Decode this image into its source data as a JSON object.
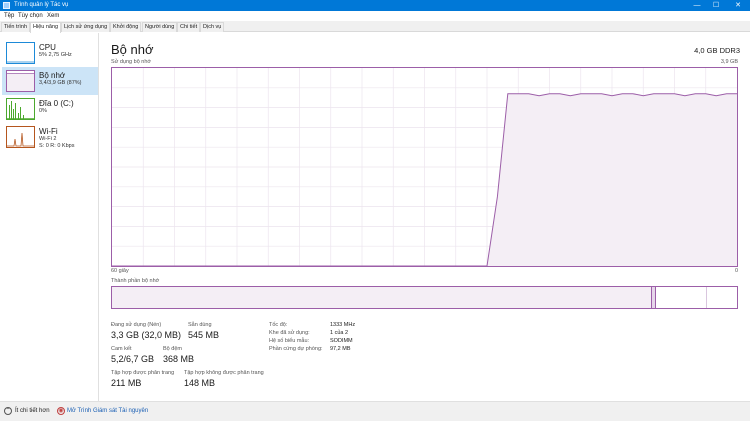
{
  "window": {
    "title": "Trình quản lý Tác vụ",
    "minimize": "—",
    "maximize": "☐",
    "close": "✕"
  },
  "menu": [
    "Tệp",
    "Tùy chọn",
    "Xem"
  ],
  "tabs": [
    "Tiến trình",
    "Hiệu năng",
    "Lịch sử ứng dụng",
    "Khởi động",
    "Người dùng",
    "Chi tiết",
    "Dịch vụ"
  ],
  "active_tab": "Hiệu năng",
  "sidebar": [
    {
      "name": "CPU",
      "sub": "5% 2,75 GHz",
      "color": "#1d8ad8"
    },
    {
      "name": "Bộ nhớ",
      "sub": "3,4/3,9 GB (87%)",
      "color": "#9c5ea8",
      "fill_fraction": 0.87
    },
    {
      "name": "Đĩa 0 (C:)",
      "sub": "0%",
      "color": "#4ca82e"
    },
    {
      "name": "Wi-Fi",
      "sub": "Wi-Fi 2",
      "sub2": "S: 0 R: 0 Kbps",
      "color": "#b5561e"
    }
  ],
  "main": {
    "title": "Bộ nhớ",
    "spec": "4,0 GB DDR3",
    "graph": {
      "label": "Sử dụng bộ nhớ",
      "max_label": "3,9 GB",
      "left_label": "60 giây",
      "right_label": "0",
      "line_color": "#9c5ea8",
      "fill_color": "#f4eef5",
      "usage_fraction": [
        0,
        0,
        0,
        0,
        0,
        0,
        0,
        0,
        0,
        0,
        0,
        0,
        0,
        0,
        0,
        0,
        0,
        0,
        0,
        0,
        0,
        0,
        0,
        0,
        0,
        0,
        0,
        0,
        0,
        0,
        0,
        0,
        0,
        0,
        0,
        0,
        0,
        0.35,
        0.87,
        0.87,
        0.87,
        0.86,
        0.87,
        0.87,
        0.86,
        0.87,
        0.87,
        0.87,
        0.86,
        0.87,
        0.87,
        0.86,
        0.87,
        0.87,
        0.87,
        0.86,
        0.87,
        0.87,
        0.86,
        0.87,
        0.87
      ]
    },
    "composition": {
      "label": "Thành phần bộ nhớ",
      "segments": [
        {
          "fraction": 0.862,
          "color": "#f4eef5"
        },
        {
          "fraction": 0.006,
          "color": "#e6d6ea"
        },
        {
          "fraction": 0.132,
          "color": "#ffffff"
        }
      ]
    },
    "stats": {
      "in_use_label": "Đang sử dụng (Nén)",
      "in_use_value": "3,3 GB (32,0 MB)",
      "available_label": "Sẵn dùng",
      "available_value": "545 MB",
      "committed_label": "Cam kết",
      "committed_value": "5,2/6,7 GB",
      "cached_label": "Bộ đệm",
      "cached_value": "368 MB",
      "paged_label": "Tập hợp được phân trang",
      "paged_value": "211 MB",
      "nonpaged_label": "Tập hợp không được phân trang",
      "nonpaged_value": "148 MB"
    },
    "specs": [
      {
        "label": "Tốc độ:",
        "value": "1333 MHz"
      },
      {
        "label": "Khe đã sử dụng:",
        "value": "1 của 2"
      },
      {
        "label": "Hệ số biểu mẫu:",
        "value": "SODIMM"
      },
      {
        "label": "Phần cứng dự phòng:",
        "value": "97,2 MB"
      }
    ]
  },
  "footer": {
    "fewer_details": "Ít chi tiết hơn",
    "fewer_icon": "⌃",
    "open_monitor": "Mở Trình Giám sát Tài nguyên",
    "monitor_icon": "◉"
  }
}
